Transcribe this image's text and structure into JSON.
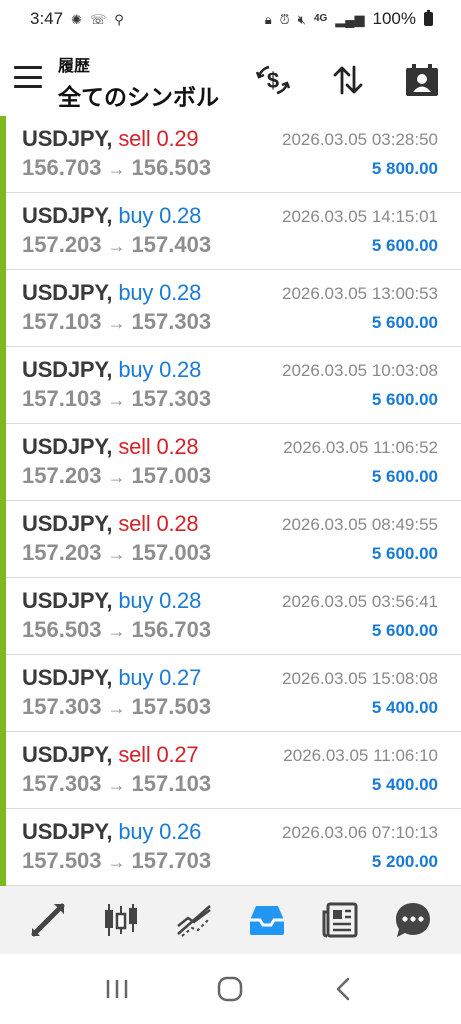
{
  "status_bar": {
    "time": "3:47",
    "network": "4G",
    "battery": "100%"
  },
  "header": {
    "subtitle": "履歴",
    "title": "全てのシンボル"
  },
  "trades": [
    {
      "symbol": "USDJPY,",
      "side": "sell",
      "volume": "0.29",
      "open_price": "156.703",
      "close_price": "156.503",
      "time": "2026.03.05 03:28:50",
      "profit": "5 800.00"
    },
    {
      "symbol": "USDJPY,",
      "side": "buy",
      "volume": "0.28",
      "open_price": "157.203",
      "close_price": "157.403",
      "time": "2026.03.05 14:15:01",
      "profit": "5 600.00"
    },
    {
      "symbol": "USDJPY,",
      "side": "buy",
      "volume": "0.28",
      "open_price": "157.103",
      "close_price": "157.303",
      "time": "2026.03.05 13:00:53",
      "profit": "5 600.00"
    },
    {
      "symbol": "USDJPY,",
      "side": "buy",
      "volume": "0.28",
      "open_price": "157.103",
      "close_price": "157.303",
      "time": "2026.03.05 10:03:08",
      "profit": "5 600.00"
    },
    {
      "symbol": "USDJPY,",
      "side": "sell",
      "volume": "0.28",
      "open_price": "157.203",
      "close_price": "157.003",
      "time": "2026.03.05 11:06:52",
      "profit": "5 600.00"
    },
    {
      "symbol": "USDJPY,",
      "side": "sell",
      "volume": "0.28",
      "open_price": "157.203",
      "close_price": "157.003",
      "time": "2026.03.05 08:49:55",
      "profit": "5 600.00"
    },
    {
      "symbol": "USDJPY,",
      "side": "buy",
      "volume": "0.28",
      "open_price": "156.503",
      "close_price": "156.703",
      "time": "2026.03.05 03:56:41",
      "profit": "5 600.00"
    },
    {
      "symbol": "USDJPY,",
      "side": "buy",
      "volume": "0.27",
      "open_price": "157.303",
      "close_price": "157.503",
      "time": "2026.03.05 15:08:08",
      "profit": "5 400.00"
    },
    {
      "symbol": "USDJPY,",
      "side": "sell",
      "volume": "0.27",
      "open_price": "157.303",
      "close_price": "157.103",
      "time": "2026.03.05 11:06:10",
      "profit": "5 400.00"
    },
    {
      "symbol": "USDJPY,",
      "side": "buy",
      "volume": "0.26",
      "open_price": "157.503",
      "close_price": "157.703",
      "time": "2026.03.06 07:10:13",
      "profit": "5 200.00"
    }
  ],
  "arrow": "→",
  "colors": {
    "sell": "#d2232a",
    "buy": "#1a7bd6",
    "profit": "#1a7bd6",
    "row_marker": "#7cb81e",
    "active_nav": "#2196f3"
  },
  "bottom_nav": [
    {
      "icon": "trade-arrows-icon",
      "active": false
    },
    {
      "icon": "candlestick-chart-icon",
      "active": false
    },
    {
      "icon": "trend-line-icon",
      "active": false
    },
    {
      "icon": "history-inbox-icon",
      "active": true
    },
    {
      "icon": "news-icon",
      "active": false
    },
    {
      "icon": "chat-icon",
      "active": false
    }
  ]
}
